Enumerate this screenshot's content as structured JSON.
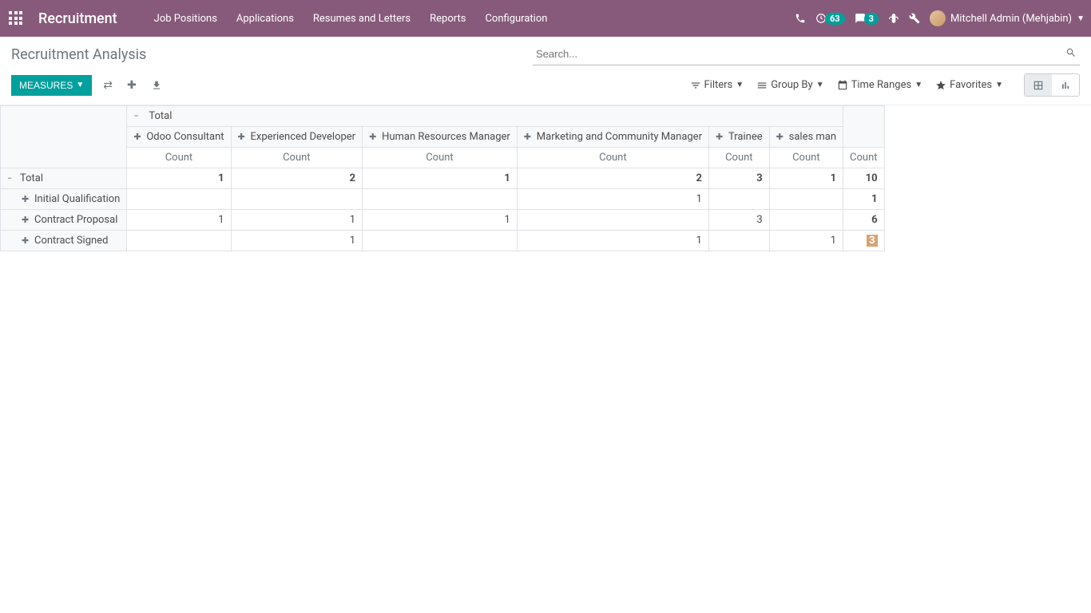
{
  "navbar": {
    "brand": "Recruitment",
    "menu": [
      "Job Positions",
      "Applications",
      "Resumes and Letters",
      "Reports",
      "Configuration"
    ],
    "badge1": "63",
    "badge2": "3",
    "user": "Mitchell Admin (Mehjabin)"
  },
  "breadcrumb": "Recruitment Analysis",
  "search": {
    "placeholder": "Search..."
  },
  "controls": {
    "measures": "MEASURES",
    "filters": "Filters",
    "groupby": "Group By",
    "timeranges": "Time Ranges",
    "favorites": "Favorites"
  },
  "pivot": {
    "total_label": "Total",
    "count_label": "Count",
    "columns": [
      "Odoo Consultant",
      "Experienced Developer",
      "Human Resources Manager",
      "Marketing and Community Manager",
      "Trainee",
      "sales man"
    ],
    "rows": [
      {
        "label": "Total",
        "level": 0,
        "expanded": true,
        "values": [
          "1",
          "2",
          "1",
          "2",
          "3",
          "1",
          "10"
        ],
        "bold": true
      },
      {
        "label": "Initial Qualification",
        "level": 1,
        "expanded": false,
        "values": [
          "",
          "",
          "",
          "1",
          "",
          "",
          "1"
        ],
        "bold": false
      },
      {
        "label": "Contract Proposal",
        "level": 1,
        "expanded": false,
        "values": [
          "1",
          "1",
          "1",
          "",
          "3",
          "",
          "6"
        ],
        "bold": false
      },
      {
        "label": "Contract Signed",
        "level": 1,
        "expanded": false,
        "values": [
          "",
          "1",
          "",
          "1",
          "",
          "1",
          "3"
        ],
        "bold": false,
        "highlight_last": true
      }
    ]
  }
}
